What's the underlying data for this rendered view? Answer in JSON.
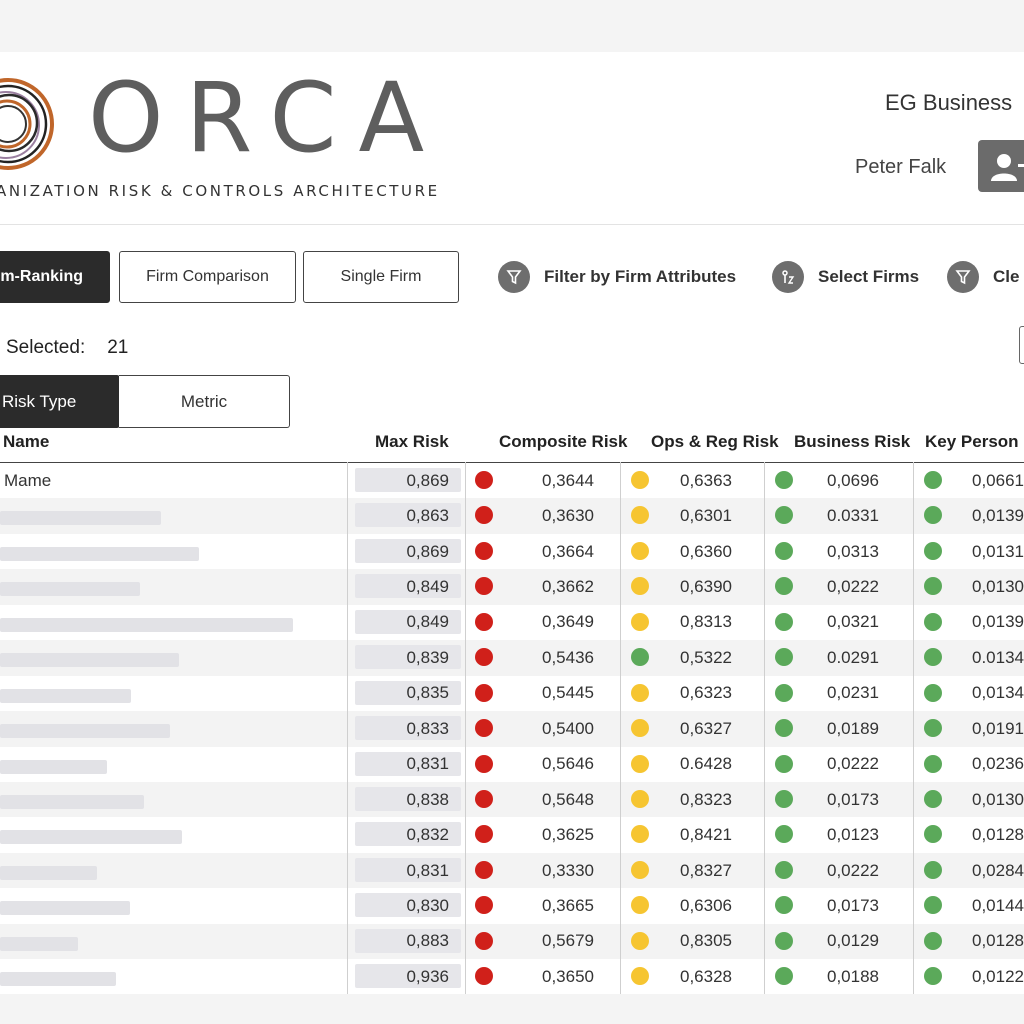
{
  "header": {
    "logo_text": "ORCA",
    "logo_subtitle": "ANIZATION RISK & CONTROLS ARCHITECTURE",
    "org_name": "EG Business",
    "user_name": "Peter Falk"
  },
  "view_tabs": [
    {
      "label": "m-Ranking",
      "active": true
    },
    {
      "label": "Firm Comparison",
      "active": false
    },
    {
      "label": "Single Firm",
      "active": false
    }
  ],
  "toolbar": {
    "filter_label": "Filter by Firm Attributes",
    "select_label": "Select Firms",
    "clear_label": "Cle"
  },
  "selection": {
    "label": "Selected:",
    "count": "21"
  },
  "segment": {
    "risk_type": "Risk Type",
    "metric": "Metric"
  },
  "table": {
    "columns": {
      "name": "Name",
      "max_risk": "Max Risk",
      "composite_risk": "Composite Risk",
      "ops_reg_risk": "Ops & Reg Risk",
      "business_risk": "Business Risk",
      "key_person": "Key Person R"
    },
    "status_colors": {
      "red": "#d0201a",
      "yellow": "#f6c531",
      "green": "#5ba95a"
    },
    "rows": [
      {
        "name": "Mame",
        "max": "0,869",
        "comp_status": "red",
        "comp": "0,3644",
        "ops_status": "yellow",
        "ops": "0,6363",
        "bus_status": "green",
        "bus": "0,0696",
        "key_status": "green",
        "key": "0,0661"
      },
      {
        "name": "",
        "max": "0,863",
        "comp_status": "red",
        "comp": "0,3630",
        "ops_status": "yellow",
        "ops": "0,6301",
        "bus_status": "green",
        "bus": "0.0331",
        "key_status": "green",
        "key": "0,0139"
      },
      {
        "name": "",
        "max": "0,869",
        "comp_status": "red",
        "comp": "0,3664",
        "ops_status": "yellow",
        "ops": "0,6360",
        "bus_status": "green",
        "bus": "0,0313",
        "key_status": "green",
        "key": "0,0131"
      },
      {
        "name": "",
        "max": "0,849",
        "comp_status": "red",
        "comp": "0,3662",
        "ops_status": "yellow",
        "ops": "0,6390",
        "bus_status": "green",
        "bus": "0,0222",
        "key_status": "green",
        "key": "0,0130"
      },
      {
        "name": "",
        "max": "0,849",
        "comp_status": "red",
        "comp": "0,3649",
        "ops_status": "yellow",
        "ops": "0,8313",
        "bus_status": "green",
        "bus": "0,0321",
        "key_status": "green",
        "key": "0,0139"
      },
      {
        "name": "",
        "max": "0,839",
        "comp_status": "red",
        "comp": "0,5436",
        "ops_status": "green",
        "ops": "0,5322",
        "bus_status": "green",
        "bus": "0.0291",
        "key_status": "green",
        "key": "0.0134"
      },
      {
        "name": "",
        "max": "0,835",
        "comp_status": "red",
        "comp": "0,5445",
        "ops_status": "yellow",
        "ops": "0,6323",
        "bus_status": "green",
        "bus": "0,0231",
        "key_status": "green",
        "key": "0,0134"
      },
      {
        "name": "",
        "max": "0,833",
        "comp_status": "red",
        "comp": "0,5400",
        "ops_status": "yellow",
        "ops": "0,6327",
        "bus_status": "green",
        "bus": "0,0189",
        "key_status": "green",
        "key": "0,0191"
      },
      {
        "name": "",
        "max": "0,831",
        "comp_status": "red",
        "comp": "0,5646",
        "ops_status": "yellow",
        "ops": "0.6428",
        "bus_status": "green",
        "bus": "0,0222",
        "key_status": "green",
        "key": "0,0236"
      },
      {
        "name": "",
        "max": "0,838",
        "comp_status": "red",
        "comp": "0,5648",
        "ops_status": "yellow",
        "ops": "0,8323",
        "bus_status": "green",
        "bus": "0,0173",
        "key_status": "green",
        "key": "0,0130"
      },
      {
        "name": "",
        "max": "0,832",
        "comp_status": "red",
        "comp": "0,3625",
        "ops_status": "yellow",
        "ops": "0,8421",
        "bus_status": "green",
        "bus": "0,0123",
        "key_status": "green",
        "key": "0,0128"
      },
      {
        "name": "",
        "max": "0,831",
        "comp_status": "red",
        "comp": "0,3330",
        "ops_status": "yellow",
        "ops": "0,8327",
        "bus_status": "green",
        "bus": "0,0222",
        "key_status": "green",
        "key": "0,0284"
      },
      {
        "name": "",
        "max": "0,830",
        "comp_status": "red",
        "comp": "0,3665",
        "ops_status": "yellow",
        "ops": "0,6306",
        "bus_status": "green",
        "bus": "0,0173",
        "key_status": "green",
        "key": "0,0144"
      },
      {
        "name": "",
        "max": "0,883",
        "comp_status": "red",
        "comp": "0,5679",
        "ops_status": "yellow",
        "ops": "0,8305",
        "bus_status": "green",
        "bus": "0,0129",
        "key_status": "green",
        "key": "0,0128"
      },
      {
        "name": "",
        "max": "0,936",
        "comp_status": "red",
        "comp": "0,3650",
        "ops_status": "yellow",
        "ops": "0,6328",
        "bus_status": "green",
        "bus": "0,0188",
        "key_status": "green",
        "key": "0,0122"
      }
    ]
  }
}
